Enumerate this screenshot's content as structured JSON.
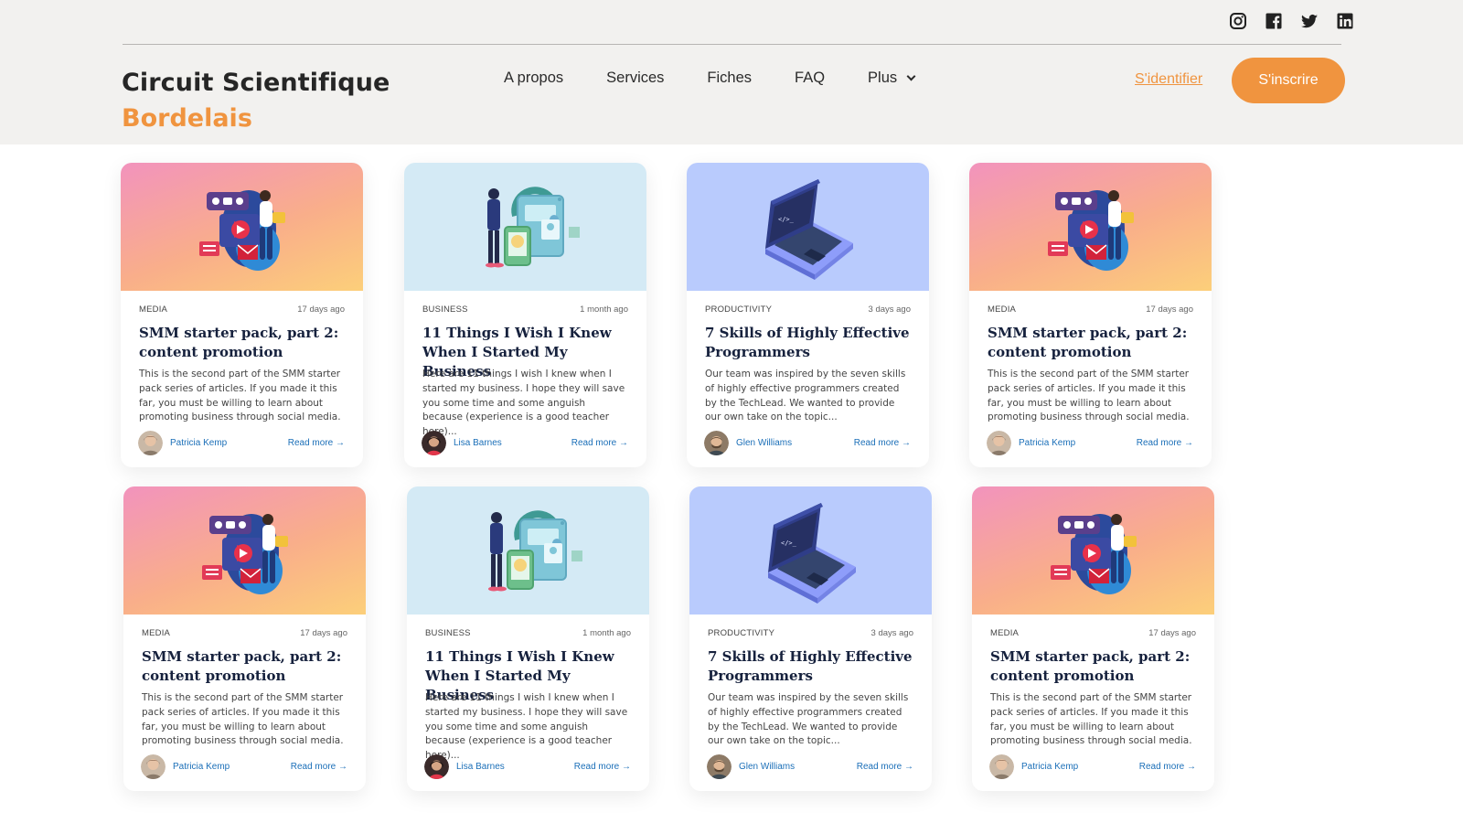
{
  "brand": {
    "line1": "Circuit Scientifique",
    "line2": "Bordelais",
    "accent_color": "#f0943f"
  },
  "social": [
    {
      "name": "instagram-icon"
    },
    {
      "name": "facebook-icon"
    },
    {
      "name": "twitter-icon"
    },
    {
      "name": "linkedin-icon"
    }
  ],
  "nav": {
    "items": [
      "A propos",
      "Services",
      "Fiches",
      "FAQ"
    ],
    "more_label": "Plus"
  },
  "auth": {
    "signin_label": "S'identifier",
    "signup_label": "S'inscrire"
  },
  "posts": [
    {
      "category": "MEDIA",
      "time": "17 days ago",
      "title": "SMM starter pack, part 2: content promotion",
      "description": "This is the second part of the SMM starter pack series of articles. If you made it this far, you must be willing to learn about promoting business through social media.",
      "author": "Patricia Kemp",
      "read_more": "Read more →",
      "theme": "media"
    },
    {
      "category": "BUSINESS",
      "time": "1 month ago",
      "title": "11 Things I Wish I Knew When I Started My Business",
      "description": "Here are 11 things I wish I knew when I started my business. I hope they will save you some time and some anguish because (experience is a good teacher here)...",
      "author": "Lisa Barnes",
      "read_more": "Read more →",
      "theme": "business"
    },
    {
      "category": "PRODUCTIVITY",
      "time": "3 days ago",
      "title": "7 Skills of Highly Effective Programmers",
      "description": "Our team was inspired by the seven skills of highly effective programmers created by the TechLead. We wanted to provide our own take on the topic...",
      "author": "Glen Williams",
      "read_more": "Read more →",
      "theme": "productivity"
    },
    {
      "category": "MEDIA",
      "time": "17 days ago",
      "title": "SMM starter pack, part 2: content promotion",
      "description": "This is the second part of the SMM starter pack series of articles. If you made it this far, you must be willing to learn about promoting business through social media.",
      "author": "Patricia Kemp",
      "read_more": "Read more →",
      "theme": "media"
    },
    {
      "category": "MEDIA",
      "time": "17 days ago",
      "title": "SMM starter pack, part 2: content promotion",
      "description": "This is the second part of the SMM starter pack series of articles. If you made it this far, you must be willing to learn about promoting business through social media.",
      "author": "Patricia Kemp",
      "read_more": "Read more →",
      "theme": "media"
    },
    {
      "category": "BUSINESS",
      "time": "1 month ago",
      "title": "11 Things I Wish I Knew When I Started My Business",
      "description": "Here are 11 things I wish I knew when I started my business. I hope they will save you some time and some anguish because (experience is a good teacher here)...",
      "author": "Lisa Barnes",
      "read_more": "Read more →",
      "theme": "business"
    },
    {
      "category": "PRODUCTIVITY",
      "time": "3 days ago",
      "title": "7 Skills of Highly Effective Programmers",
      "description": "Our team was inspired by the seven skills of highly effective programmers created by the TechLead. We wanted to provide our own take on the topic...",
      "author": "Glen Williams",
      "read_more": "Read more →",
      "theme": "productivity"
    },
    {
      "category": "MEDIA",
      "time": "17 days ago",
      "title": "SMM starter pack, part 2: content promotion",
      "description": "This is the second part of the SMM starter pack series of articles. If you made it this far, you must be willing to learn about promoting business through social media.",
      "author": "Patricia Kemp",
      "read_more": "Read more →",
      "theme": "media"
    }
  ]
}
